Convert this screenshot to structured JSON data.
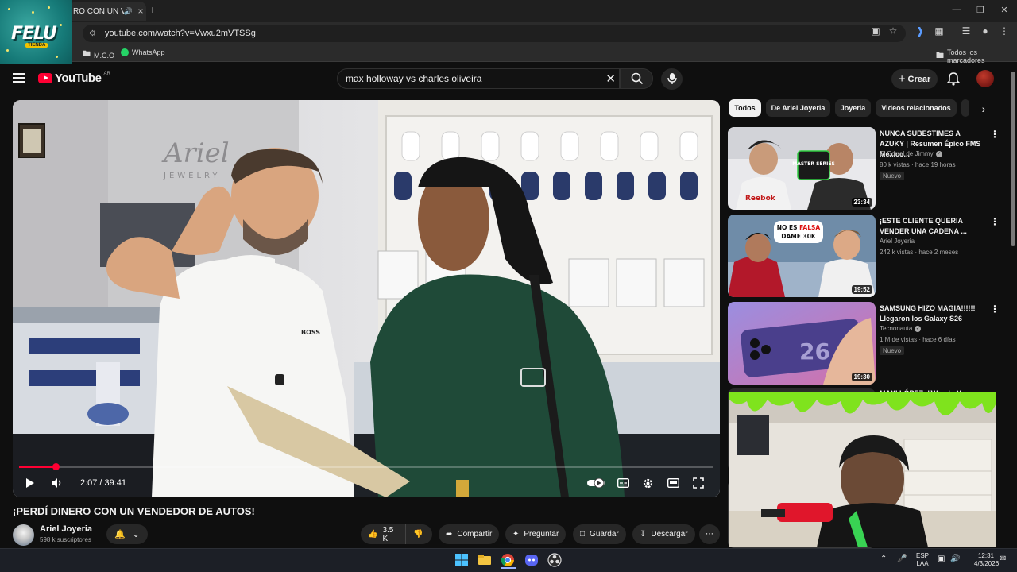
{
  "browser": {
    "tab_title": "RO CON UN VE",
    "url": "youtube.com/watch?v=Vwxu2mVTSSg",
    "bookmarks": [
      {
        "label": "M.C.O",
        "icon": "folder-icon"
      },
      {
        "label": "WhatsApp",
        "icon": "whatsapp-icon"
      }
    ],
    "all_bookmarks": "Todos los marcadores"
  },
  "overlay_logo": {
    "word": "FELU",
    "sub": "TIENDA"
  },
  "youtube": {
    "logo_text": "YouTube",
    "country": "AR",
    "search_value": "max holloway vs charles oliveira",
    "create_label": "Crear"
  },
  "player": {
    "current_time": "2:07",
    "duration": "39:41",
    "progress": 0.053,
    "shirt_brand": "BOSS"
  },
  "video": {
    "title": "¡PERDÍ DINERO CON UN VENDEDOR DE AUTOS!",
    "channel": "Ariel Joyeria",
    "subscribers": "598 k suscriptores",
    "likes": "3.5 K",
    "share": "Compartir",
    "ask": "Preguntar",
    "save": "Guardar",
    "download": "Descargar"
  },
  "chips": [
    "Todos",
    "De Ariel Joyeria",
    "Joyeria",
    "Videos relacionados"
  ],
  "recommendations": [
    {
      "title": "NUNCA SUBESTIMES A AZUKY | Resumen Épico FMS México...",
      "channel": "El Corral de Jimmy",
      "verified": true,
      "meta": "80 k vistas · hace 19 horas",
      "badge": "Nuevo",
      "duration": "23:34",
      "thumb_text": "MASTER SERIES"
    },
    {
      "title": "¡ESTE CLIENTE QUERIA VENDER UNA CADENA ...",
      "channel": "Ariel Joyeria",
      "verified": false,
      "meta": "242 k vistas · hace 2 meses",
      "badge": "",
      "duration": "19:52",
      "thumb_text": "NO ES FALSA DAME 30K"
    },
    {
      "title": "SAMSUNG HIZO MAGIA!!!!!! Llegaron los Galaxy S26",
      "channel": "Tecnonauta",
      "verified": true,
      "meta": "1 M de vistas · hace 6 días",
      "badge": "Nuevo",
      "duration": "19:30",
      "thumb_text": "26"
    }
  ],
  "partial_rec_title": "MAXI LÓPEZ: \"Wanda Nara me",
  "taskbar": {
    "lang": "ESP",
    "lang2": "LAA",
    "time": "12:31",
    "date": "4/3/2026"
  },
  "colors": {
    "accent": "#ff0033",
    "background": "#0f0f0f",
    "chip": "#272727"
  }
}
